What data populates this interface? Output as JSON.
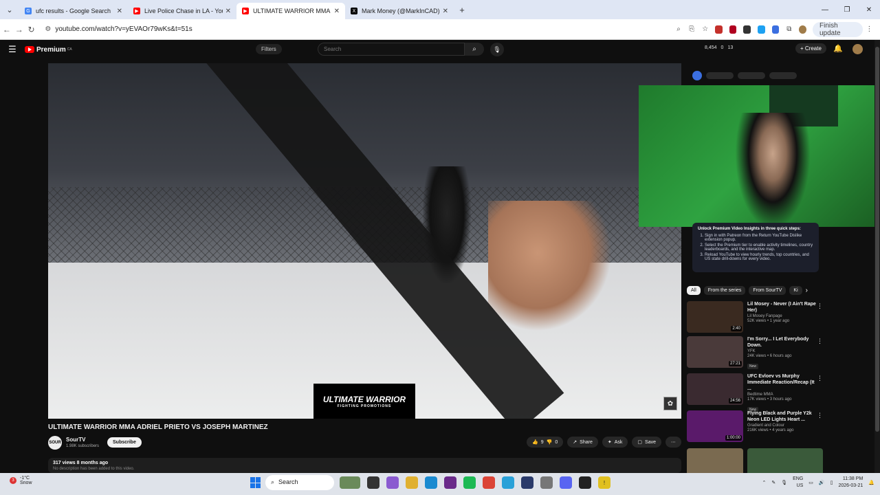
{
  "browser": {
    "tabs": [
      {
        "title": "ufc results - Google Search",
        "favicon_color": "#4285f4",
        "active": false
      },
      {
        "title": "Live Police Chase in LA - YouTu",
        "favicon_color": "#ff0000",
        "active": false
      },
      {
        "title": "ULTIMATE WARRIOR MMA ADI",
        "favicon_color": "#ff0000",
        "active": true
      },
      {
        "title": "Mark Money (@MarkInCAD) / X",
        "favicon_color": "#000000",
        "active": false
      }
    ],
    "url": "youtube.com/watch?v=yEVAOr79wKs&t=51s",
    "finish_update_label": "Finish update"
  },
  "youtube": {
    "logo_text": "Premium",
    "logo_region": "CA",
    "filters_label": "Filters",
    "search_placeholder": "Search",
    "stats": {
      "views": "8,454",
      "a": "0",
      "b": "13"
    },
    "create_label": "Create"
  },
  "video": {
    "title": "ULTIMATE WARRIOR MMA ADRIEL PRIETO VS JOSEPH MARTINEZ",
    "overlay_logo": "ULTIMATE WARRIOR",
    "overlay_logo_sub": "FIGHTING PROMOTIONS",
    "channel_name": "SourTV",
    "channel_subs": "1.98K subscribers",
    "subscribe_label": "Subscribe",
    "likes": "9",
    "dislikes": "0",
    "share_label": "Share",
    "ask_label": "Ask",
    "save_label": "Save",
    "views_date": "317 views  8 months ago",
    "description": "No description has been added to this video."
  },
  "premium_box": {
    "heading": "Unlock Premium Video Insights in three quick steps:",
    "steps": [
      "Sign in with Patreon from the Return YouTube Dislike extension popup.",
      "Select the Premium tier to enable activity timelines, country leaderboards, and the interactive map.",
      "Reload YouTube to view hourly trends, top countries, and US state drill-downs for every video."
    ]
  },
  "chips": [
    "All",
    "From the series",
    "From SourTV",
    "Ki"
  ],
  "recommendations": [
    {
      "title": "Lil Mosey - Never (I Ain't Rape Her)",
      "channel": "Lil Mosey Fanpage",
      "stats": "52K views • 1 year ago",
      "duration": "2:40",
      "new": "",
      "color": "#3a2a20"
    },
    {
      "title": "I'm Sorry... I Let Everybody Down.",
      "channel": "YFK",
      "stats": "24K views • 6 hours ago",
      "duration": "27:21",
      "new": "New",
      "color": "#4a3a3a"
    },
    {
      "title": "UFC Evloev vs Murphy Immediate Reaction/Recap (It ...",
      "channel": "Bedtime MMA",
      "stats": "17K views • 3 hours ago",
      "duration": "24:56",
      "new": "New",
      "color": "#3a2a30"
    },
    {
      "title": "Flying Black and Purple Y2k Neon LED Lights Heart ...",
      "channel": "Gradient and Colour",
      "stats": "216K views • 4 years ago",
      "duration": "1:00:00",
      "new": "",
      "color": "#5a1a6a"
    }
  ],
  "taskbar": {
    "weather_temp": "-1°C",
    "weather_desc": "Snow",
    "weather_badge": "3",
    "search_label": "Search",
    "lang": "ENG",
    "region": "US",
    "time": "11:38 PM",
    "date": "2026-03-21"
  }
}
